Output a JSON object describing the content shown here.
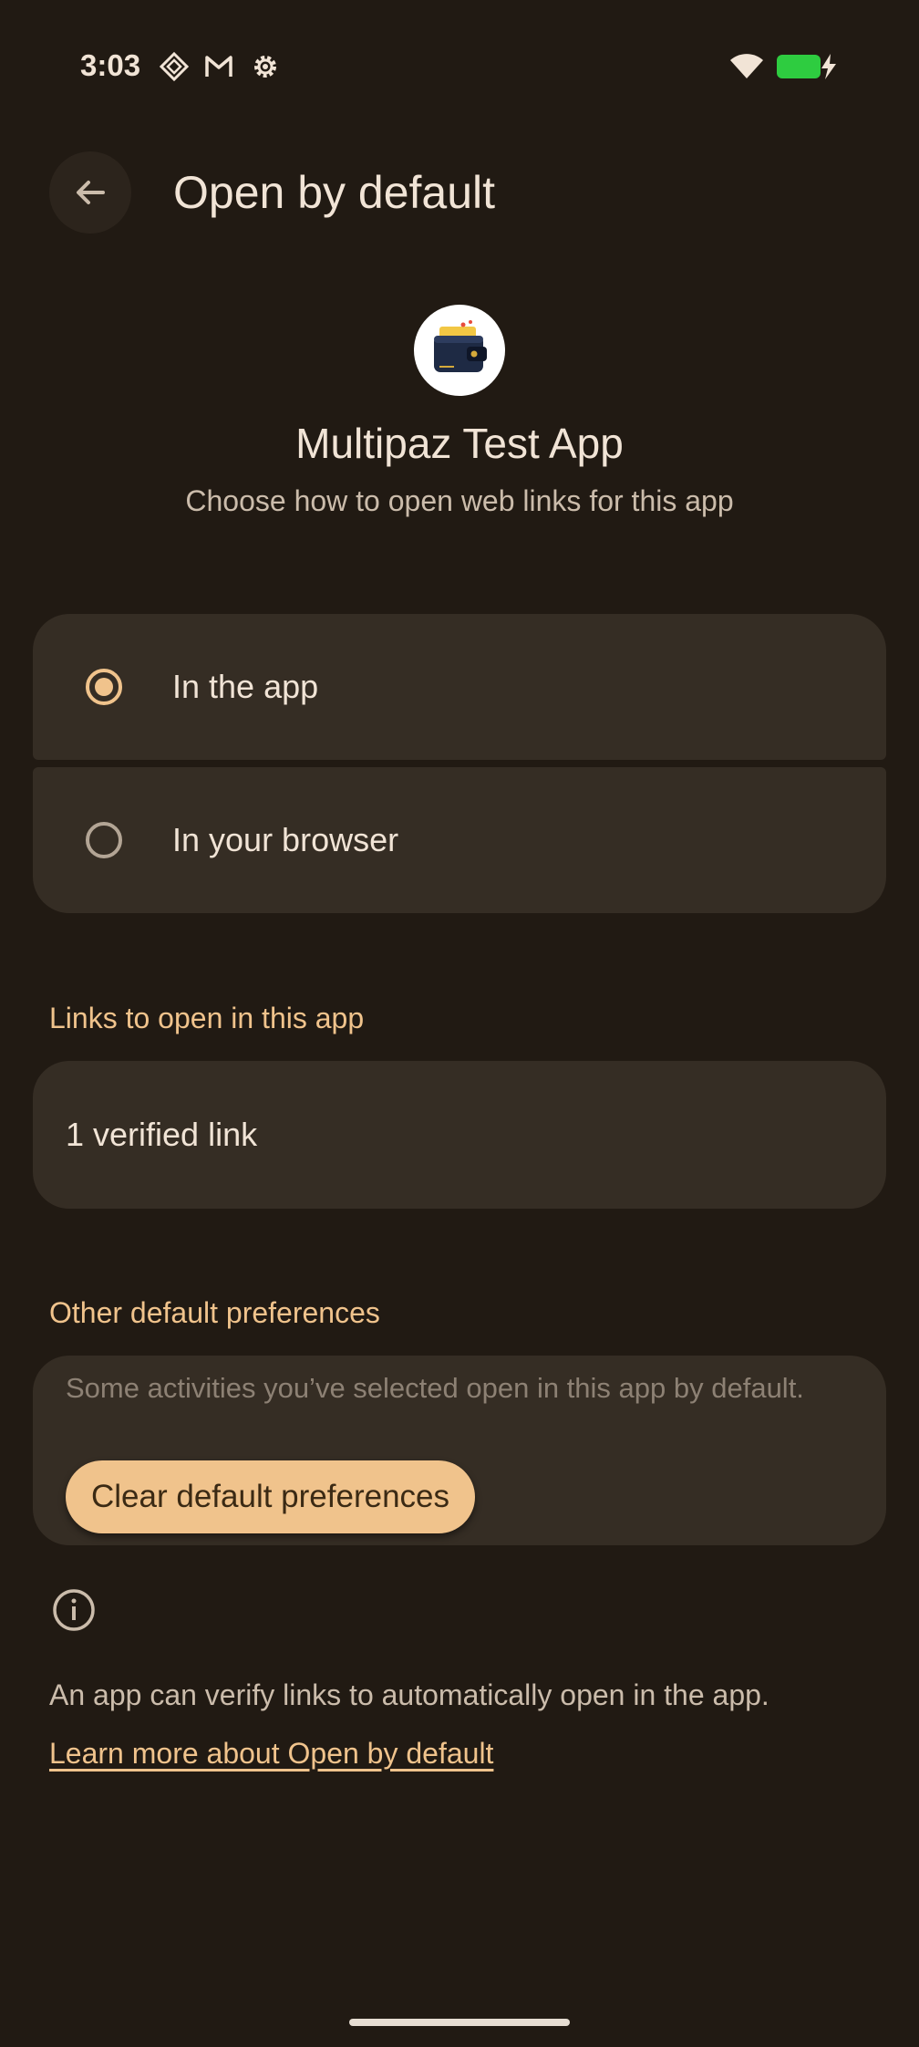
{
  "status_bar": {
    "time": "3:03",
    "icons": [
      "puzzle-icon",
      "gmail-icon",
      "settings-gear-icon",
      "wifi-icon",
      "battery-charging-icon"
    ],
    "battery_color": "#2ecc40"
  },
  "header": {
    "title": "Open by default",
    "back_icon": "arrow-back-icon"
  },
  "app": {
    "name": "Multipaz Test App",
    "subtitle": "Choose how to open web links for this app",
    "icon": "wallet-icon"
  },
  "open_options": {
    "items": [
      {
        "label": "In the app",
        "selected": true
      },
      {
        "label": "In your browser",
        "selected": false
      }
    ]
  },
  "links_section": {
    "title": "Links to open in this app",
    "verified": "1 verified link"
  },
  "other_prefs": {
    "title": "Other default preferences",
    "description": "Some activities you’ve selected open in this app by default.",
    "clear_button": "Clear default preferences"
  },
  "footer": {
    "info_icon": "info-icon",
    "info_text": "An app can verify links to automatically open in the app.",
    "learn_more": "Learn more about Open by default"
  },
  "colors": {
    "background": "#211a13",
    "surface": "#352d24",
    "accent": "#f0c38c"
  }
}
